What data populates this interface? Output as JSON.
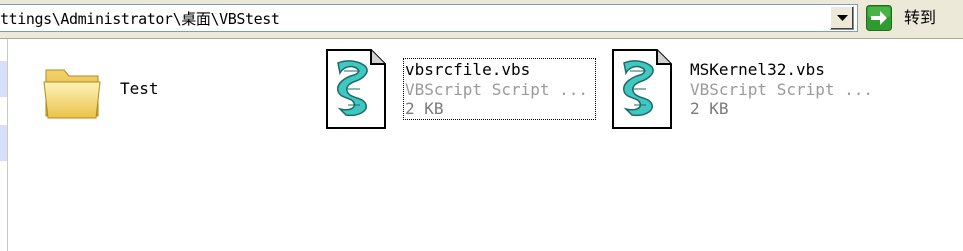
{
  "address_bar": {
    "path": "ttings\\Administrator\\桌面\\VBStest",
    "dropdown_icon": "chevron-down-icon",
    "go_label": "转到",
    "go_icon": "green-arrow-right-icon"
  },
  "files": [
    {
      "name": "Test",
      "kind": "folder",
      "icon": "folder-icon"
    },
    {
      "name": "vbsrcfile.vbs",
      "type": "VBScript Script ...",
      "size": "2 KB",
      "icon": "vbscript-file-icon",
      "focused": true
    },
    {
      "name": "MSKernel32.vbs",
      "type": "VBScript Script ...",
      "size": "2 KB",
      "icon": "vbscript-file-icon",
      "focused": false
    }
  ],
  "colors": {
    "chrome": "#ece9d8",
    "address_border": "#7f9db9",
    "go_green": "#2f9a2f",
    "folder_yellow": "#f6d86a",
    "script_teal": "#3fc7c0",
    "type_gray": "#9a9a9a"
  }
}
